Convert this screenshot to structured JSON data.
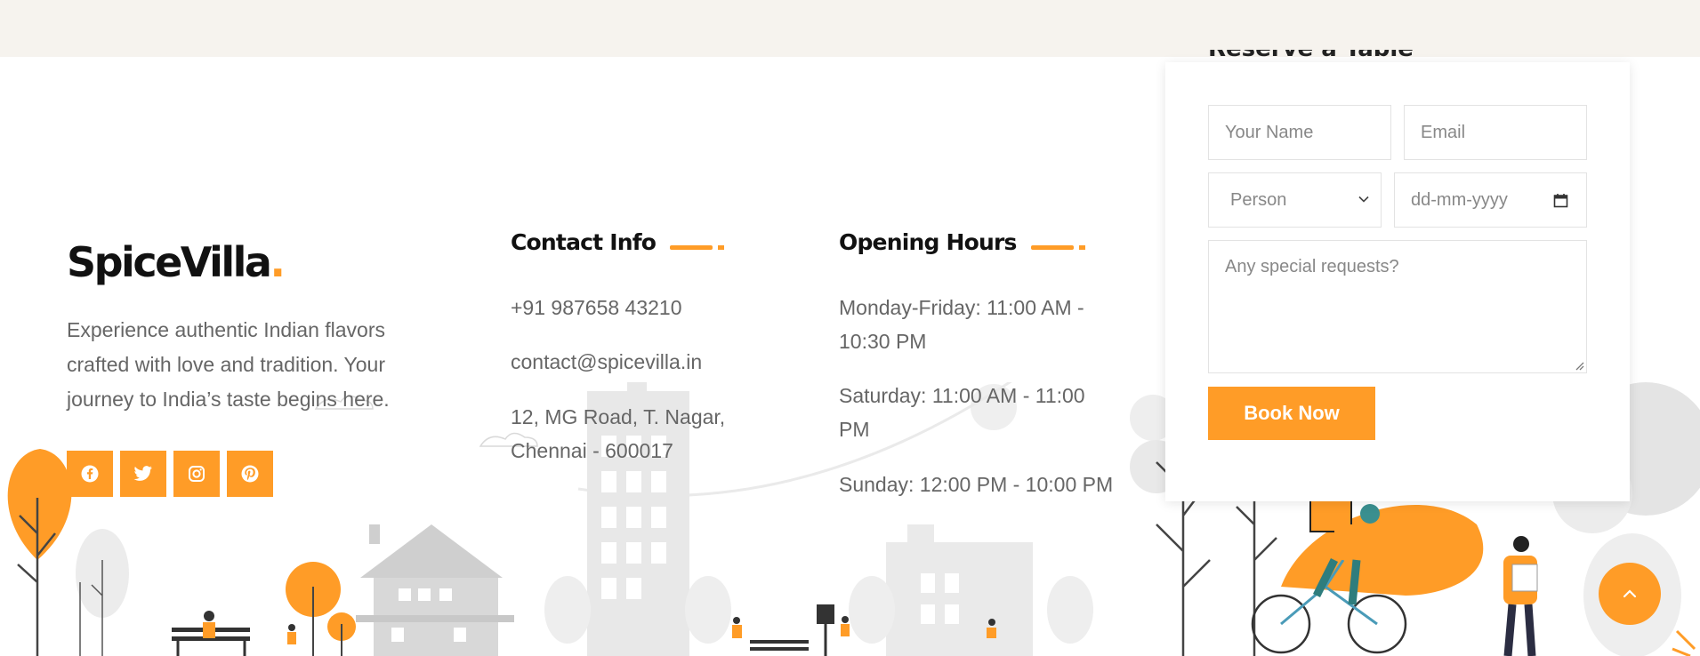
{
  "brand": {
    "name": "SpiceVilla",
    "dot": ".",
    "accent": "#ff9c27"
  },
  "about": {
    "text": "Experience authentic Indian flavors crafted with love and tradition. Your journey to India’s taste begins here."
  },
  "socials": [
    {
      "icon": "facebook-icon"
    },
    {
      "icon": "twitter-icon"
    },
    {
      "icon": "instagram-icon"
    },
    {
      "icon": "pinterest-icon"
    }
  ],
  "contact": {
    "title": "Contact Info",
    "phone": "+91 987658 43210",
    "email": "contact@spicevilla.in",
    "address_line1": "12, MG Road, T. Nagar,",
    "address_line2": "Chennai - 600017"
  },
  "hours": {
    "title": "Opening Hours",
    "weekday_line1": "Monday-Friday: 11:00 AM -",
    "weekday_line2": "10:30 PM",
    "saturday_line1": "Saturday: 11:00 AM - 11:00",
    "saturday_line2": "PM",
    "sunday": "Sunday: 12:00 PM - 10:00 PM"
  },
  "booking": {
    "title": "Reserve a Table",
    "name_placeholder": "Your Name",
    "email_placeholder": "Email",
    "person_value": "Person",
    "date_placeholder": "dd-mm-yyyy",
    "requests_placeholder": "Any special requests?",
    "submit_label": "Book Now"
  },
  "scroll_top": {
    "icon": "chevron-up-icon"
  }
}
